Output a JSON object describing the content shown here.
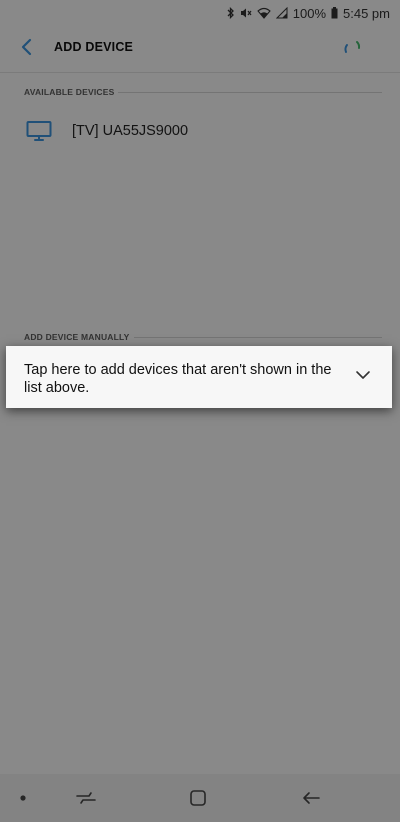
{
  "status_bar": {
    "battery": "100%",
    "time": "5:45 pm",
    "icons": [
      "bluetooth-icon",
      "mute-icon",
      "wifi-icon",
      "signal-icon",
      "battery-icon"
    ]
  },
  "header": {
    "title": "ADD DEVICE",
    "back_icon": "back-arrow-icon",
    "loading_icon": "loading-spinner-icon"
  },
  "sections": {
    "available": "AVAILABLE DEVICES",
    "manual": "ADD DEVICE MANUALLY"
  },
  "devices": [
    {
      "name": "[TV] UA55JS9000",
      "icon": "tv-icon"
    }
  ],
  "tooltip": {
    "text": "Tap here to add devices that aren't shown in the list above.",
    "icon": "chevron-down-icon"
  },
  "nav_bar": {
    "icons": [
      "dot-icon",
      "recents-icon",
      "home-icon",
      "back-icon"
    ]
  },
  "colors": {
    "accent": "#3a8fd6",
    "spinner_green": "#43b36a",
    "overlay": "#8f8f8f"
  }
}
